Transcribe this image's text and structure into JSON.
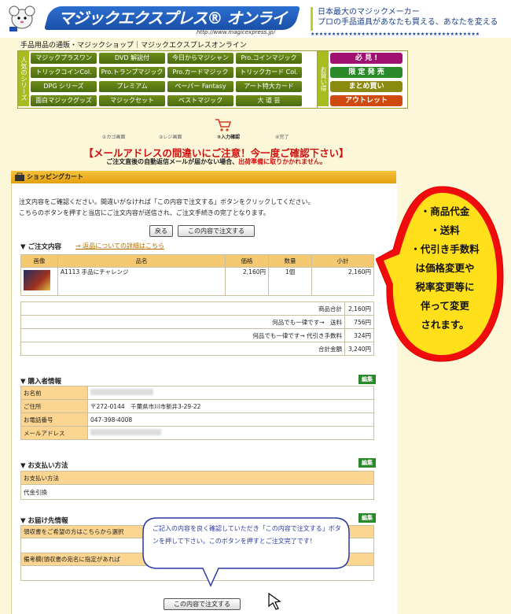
{
  "header": {
    "logo_text": "マジックエクスプレス® オンライン",
    "logo_url": "http://www.magicexpress.jp/",
    "tagline1": "日本最大のマジックメーカー",
    "tagline2": "プロの手品道具があなたも買える、あなたを変える",
    "breadcrumb": "手品用品の通販・マジックショップ｜マジックエクスプレスオンライン"
  },
  "nav": {
    "side_label": "人気のシリーズ",
    "items": [
      "マジックプラスワン",
      "DVD 解説付",
      "今日からマジシャン",
      "Pro.コインマジック",
      "トリックコインCol.",
      "Pro.トランプマジック",
      "Pro.カードマジック",
      "トリックカード Col.",
      "DPG シリーズ",
      "プレミアム",
      "ペーパー Fantasy",
      "アート特大カード",
      "面白マジックグッズ",
      "マジックセット",
      "ベストマジック",
      "大 道 芸"
    ],
    "side2_label": "お買い得",
    "specials": [
      "必 見 !",
      "限 定 発 売",
      "まとめ買い",
      "アウトレット"
    ],
    "special_colors": [
      "#a01070",
      "#2a8a2a",
      "#8a8a10",
      "#d04a10"
    ]
  },
  "steps": [
    "①カゴ画面",
    "②レジ画面",
    "③入力確認",
    "④完了"
  ],
  "warning": {
    "line1": "【メールアドレスの間違いにご注意！今一度ご確認下さい】",
    "line2a": "ご注文直後の自動返信メールが届かない場合、",
    "line2b": "出荷準備に取りかかれません。"
  },
  "cart": {
    "title": "ショッピングカート",
    "intro1": "注文内容をご確認ください。間違いがなければ「この内容で注文する」ボタンをクリックしてください。",
    "intro2": "こちらのボタンを押すと当店にご注文内容が送信され、ご注文手続きの完了となります。",
    "back_btn": "戻る",
    "order_btn": "この内容で注文する",
    "order_section": "▼ ご注文内容",
    "return_link": "→ 返品についての詳細はこちら",
    "columns": [
      "画像",
      "品名",
      "価格",
      "数量",
      "小計"
    ],
    "item": {
      "name": "A1113 手品にチャレンジ",
      "price": "2,160円",
      "qty": "1個",
      "subtotal": "2,160円"
    },
    "summary": [
      {
        "label": "商品合計",
        "value": "2,160円"
      },
      {
        "label": "何品でも一律です→　送料",
        "value": "756円"
      },
      {
        "label": "何品でも一律です→ 代引き手数料",
        "value": "324円"
      },
      {
        "label": "合計金額",
        "value": "3,240円"
      }
    ]
  },
  "buyer": {
    "title": "▼ 購入者情報",
    "edit": "編集",
    "rows": [
      {
        "label": "お名前",
        "value": ""
      },
      {
        "label": "ご住所",
        "value": "〒272-0144　千葉県市川市新井3-29-22"
      },
      {
        "label": "お電話番号",
        "value": "047-398-4008"
      },
      {
        "label": "メールアドレス",
        "value": ""
      }
    ]
  },
  "payment": {
    "title": "▼ お支払い方法",
    "edit": "編集",
    "label": "お支払い方法",
    "value": "代金引換"
  },
  "delivery": {
    "title": "▼ お届け先情報",
    "edit": "編集",
    "row1": "領収書をご希望の方はこちらから選択",
    "row2": "備考欄(領収書の宛名に指定があれば"
  },
  "bubble": {
    "lines": [
      "・商品代金",
      "・送料",
      "・代引き手数料",
      "は価格変更や",
      "税率変更等に",
      "伴って変更",
      "されます。"
    ]
  },
  "callout": {
    "text": "ご記入の内容を良く確認していただき「この内容で注文する」ボタンを押して下さい。このボタンを押すとご注文完了です！"
  },
  "bottom_btn": "この内容で注文する"
}
